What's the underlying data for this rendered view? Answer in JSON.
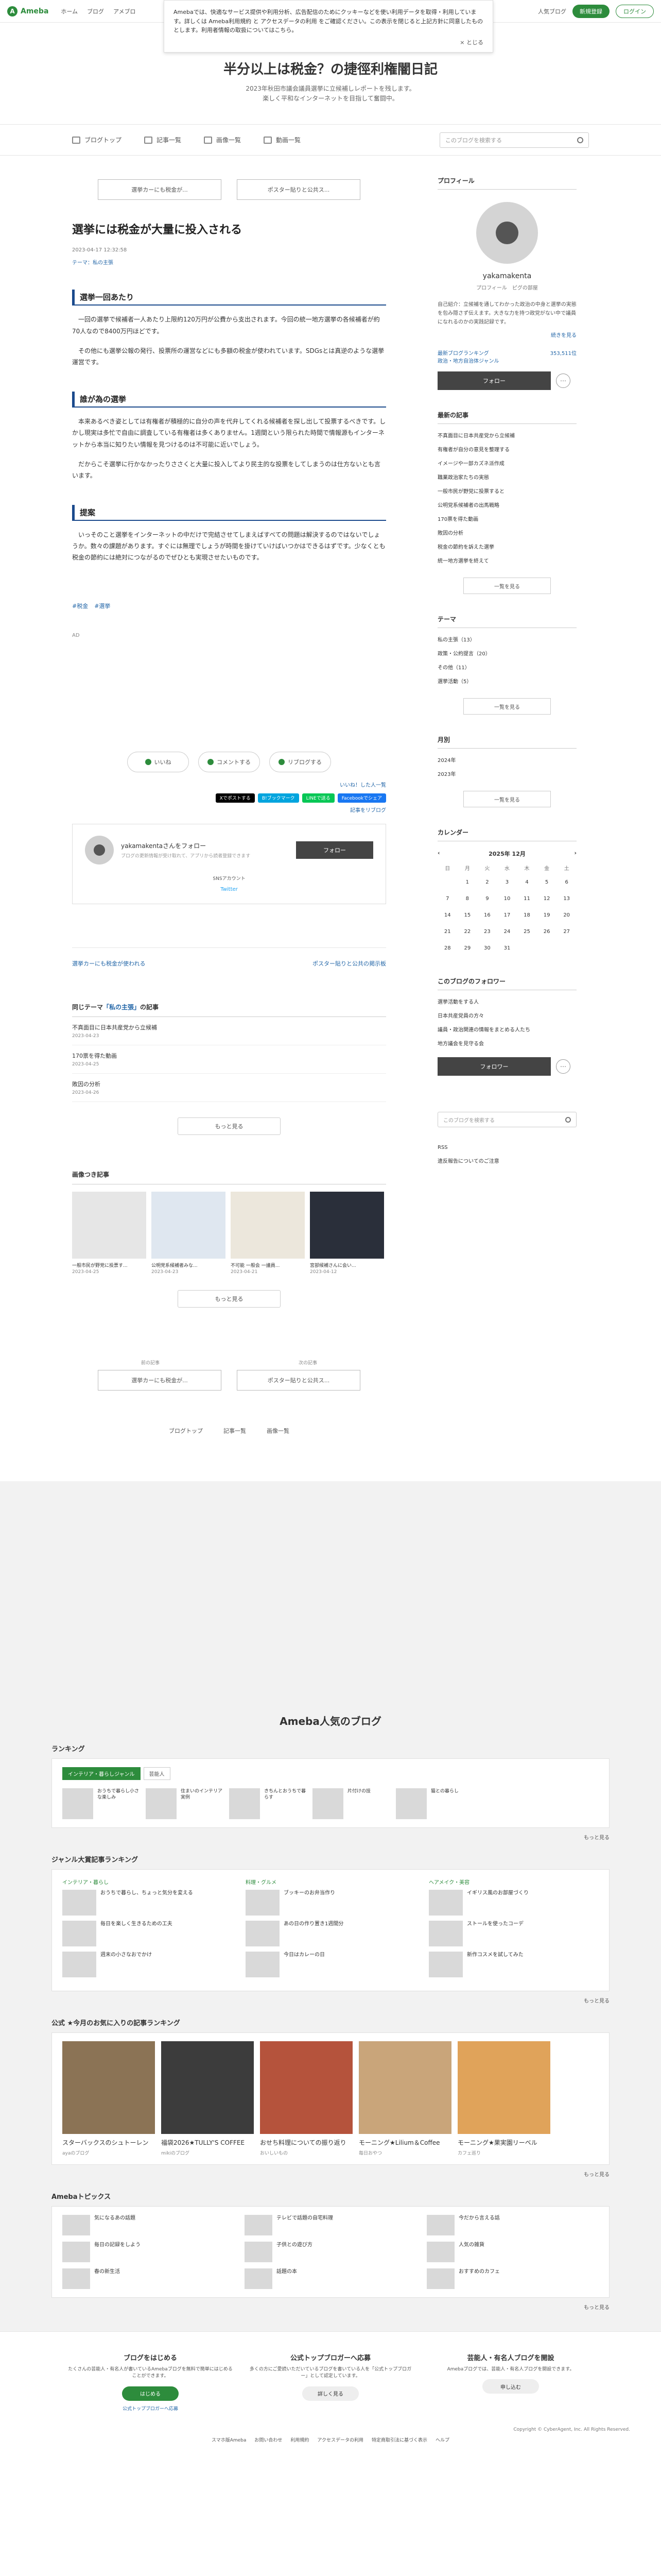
{
  "topbar": {
    "logo": "Ameba",
    "nav": [
      "ホーム",
      "ブログ",
      "アメブロ"
    ],
    "right_label": "人気ブログ",
    "signup": "新規登録",
    "login": "ログイン"
  },
  "cookie": {
    "text": "Amebaでは、快適なサービス提供や利用分析、広告配信のためにクッキーなどを使い利用データを取得・利用しています。詳しくは Ameba利用規約 と アクセスデータの利用 をご確認ください。この表示を閉じると上記方針に同意したものとします。利用者情報の取扱についてはこちら。",
    "close": "× とじる"
  },
  "blog": {
    "title": "半分以上は税金？の捷徑利権闇日記",
    "desc_1": "2023年秋田市議会議員選挙に立候補しレポートを残します。",
    "desc_2": "楽しく平和なインターネットを目指して奮闘中。"
  },
  "gnav": {
    "items": [
      "ブログトップ",
      "記事一覧",
      "画像一覧",
      "動画一覧"
    ],
    "search_placeholder": "このブログを検索する"
  },
  "pager": {
    "prev": "選挙カーにも税金が...",
    "next": "ポスター貼りと公共ス..."
  },
  "entry": {
    "title": "選挙には税金が大量に投入される",
    "meta": "2023-04-17 12:32:58",
    "theme": "テーマ：私の主張",
    "sec1": "選挙一回あたり",
    "p1": "一回の選挙で候補者一人あたり上限約120万円が公費から支出されます。今回の統一地方選挙の各候補者が約70人なので8400万円ほどです。",
    "p2": "その他にも選挙公報の発行、投票所の運営などにも多額の税金が使われています。SDGsとは真逆のような選挙運営です。",
    "sec2": "誰が為の選挙",
    "p3": "本来あるべき姿としては有権者が積極的に自分の声を代弁してくれる候補者を探し出して投票するべきです。しかし現実は多忙で自由に調査している有権者は多くありません。1週間という限られた時間で情報源もインターネットから本当に知りたい情報を見つけるのは不可能に近いでしょう。",
    "p4": "だからこそ選挙に行かなかったりささくと大量に投入してより民主的な投票をしてしまうのは仕方ないとも言います。",
    "sec3": "提案",
    "p5": "いっそのこと選挙をインターネットの中だけで完結させてしまえばすべての問題は解決するのではないでしょうか。数々の課題があります。すぐには無理でしょうが時間を掛けていけばいつかはできるはずです。少なくとも税金の節約には絶対につながるのでぜひとも実現させたいものです。",
    "hashtags": [
      "#税金",
      "#選挙"
    ],
    "ad": "AD"
  },
  "actions": {
    "like": "いいね",
    "comment": "コメントする",
    "reblog": "リブログする",
    "like_list": "いいね！した人一覧",
    "share": [
      "Xでポストする",
      "B!ブックマーク",
      "LINEで送る",
      "Facebookでシェア"
    ],
    "reblog_link": "記事をリブログ"
  },
  "follow_box": {
    "name": "yakamakentaさんをフォロー",
    "sub": "ブログの更新情報が受け取れて、アプリから読者登録できます",
    "follow": "フォロー",
    "sns": "SNSアカウント",
    "twitter": "Twitter"
  },
  "nav_links": {
    "prev": "選挙カーにも税金が使われる",
    "next": "ポスター貼りと公共の掲示板"
  },
  "same_theme": {
    "head_prefix": "同じテーマ",
    "head_theme": "「私の主張」",
    "head_suffix": "の記事",
    "items": [
      {
        "title": "不真面目に日本共産党から立候補",
        "date": "2023-04-23"
      },
      {
        "title": "170票を得た動画",
        "date": "2023-04-25"
      },
      {
        "title": "敗因の分析",
        "date": "2023-04-26"
      }
    ],
    "more": "もっと見る"
  },
  "image_articles": {
    "head": "画像つき記事",
    "items": [
      {
        "cap": "一般市民が野党に投票す...",
        "date": "2023-04-25"
      },
      {
        "cap": "公明党系候補者みな...",
        "date": "2023-04-23"
      },
      {
        "cap": "不可能 一般会 一議員...",
        "date": "2023-04-21"
      },
      {
        "cap": "宮部候補さんに会い...",
        "date": "2023-04-12"
      }
    ],
    "more": "もっと見る"
  },
  "bottom": {
    "prev_label": "前の記事",
    "next_label": "次の記事",
    "prev": "選挙カーにも税金が...",
    "next": "ポスター貼りと公共ス...",
    "nav": [
      "ブログトップ",
      "記事一覧",
      "画像一覧"
    ]
  },
  "sidebar": {
    "profile_title": "プロフィール",
    "name": "yakamakenta",
    "sub": "プロフィール　ピグの部屋",
    "desc": "自己紹介：立候補を通してわかった政治の中身と選挙の実態を包み隠さず伝えます。大きな力を持つ政党がない中で議員になれるのかの実践記録です。",
    "desc_link": "続きを見る",
    "rank_label": "最新ブログランキング",
    "rank_genre": "政治・地方自治体ジャンル",
    "rank_value": "353,511位",
    "follow": "フォロー",
    "recent_title": "最新の記事",
    "recent": [
      "不真面目に日本共産党から立候補",
      "有権者が自分の意見を整理する",
      "イメージや一部カズネ派作成",
      "職業政治家たちの実態",
      "一般市民が野党に投票すると",
      "公明党系候補者の出馬戦略",
      "170票を得た動画",
      "敗因の分析",
      "税金の節約を訴えた選挙",
      "統一地方選挙を終えて"
    ],
    "recent_more": "一覧を見る",
    "theme_title": "テーマ",
    "themes": [
      "私の主張（13）",
      "政策・公約提言（20）",
      "その他（11）",
      "選挙活動（5）"
    ],
    "theme_more": "一覧を見る",
    "month_title": "月別",
    "months": [
      "2024年",
      "2023年"
    ],
    "month_more": "一覧を見る",
    "cal_title": "カレンダー",
    "cal_month": "2025年 12月",
    "cal_days": [
      "日",
      "月",
      "火",
      "水",
      "木",
      "金",
      "土"
    ],
    "cal_weeks": [
      [
        "",
        "1",
        "2",
        "3",
        "4",
        "5",
        "6"
      ],
      [
        "7",
        "8",
        "9",
        "10",
        "11",
        "12",
        "13"
      ],
      [
        "14",
        "15",
        "16",
        "17",
        "18",
        "19",
        "20"
      ],
      [
        "21",
        "22",
        "23",
        "24",
        "25",
        "26",
        "27"
      ],
      [
        "28",
        "29",
        "30",
        "31",
        "",
        "",
        ""
      ]
    ],
    "fw_title": "このブログのフォロワー",
    "fw": [
      "選挙活動をする人",
      "日本共産党員の方々",
      "議員・政治関連の情報をまとめる人たち",
      "地方議会を見守る会"
    ],
    "fw_more": "フォロワー",
    "search_placeholder": "このブログを検索する",
    "rss": "RSS",
    "report": "違反報告についてのご注意"
  },
  "popular": {
    "title": "Ameba人気のブログ",
    "ranking_head": "ランキング",
    "tabs": [
      "インテリア・暮らしジャンル",
      "芸能人"
    ],
    "ranking_items": [
      "おうちで暮らし小さな楽しみ",
      "住まいのインテリア実例",
      "きちんとおうちで暮らす",
      "片付けの技",
      "猫との暮らし"
    ],
    "more": "もっと見る",
    "genre_head": "ジャンル大賞記事ランキング",
    "genre_cols": [
      {
        "h": "インテリア・暮らし",
        "items": [
          "おうちで暮らし、ちょっと気分を変える",
          "毎日を楽しく生きるための工夫",
          "週末の小さなおでかけ"
        ]
      },
      {
        "h": "料理・グルメ",
        "items": [
          "ブッキーのお弁当作り",
          "あの日の作り置き1週間分",
          "今日はカレーの日"
        ]
      },
      {
        "h": "ヘアメイク・美容",
        "items": [
          "イギリス風のお部屋づくり",
          "ストールを使ったコーデ",
          "新作コスメを試してみた"
        ]
      }
    ],
    "official_head": "公式 ★今月のお気に入りの記事ランキング",
    "official": [
      {
        "tx": "スターバックスのシュトーレン",
        "by": "ayaのブログ"
      },
      {
        "tx": "福袋2026★TULLY'S COFFEE",
        "by": "mikiのブログ"
      },
      {
        "tx": "おせち料理についての振り返り",
        "by": "おいしいもの"
      },
      {
        "tx": "モーニング★Lilium＆Coffee",
        "by": "毎日おやつ"
      },
      {
        "tx": "モーニング★果実園リーベル",
        "by": "カフェ巡り"
      }
    ],
    "topics_head": "Amebaトピックス",
    "topics": [
      "気になるあの話題",
      "テレビで話題の自宅料理",
      "今だから言える話",
      "毎日の記録をしよう",
      "子供との遊び方",
      "人気の雑貨",
      "春の新生活",
      "話題の本",
      "おすすめのカフェ"
    ]
  },
  "promo": [
    {
      "h": "ブログをはじめる",
      "t": "たくさんの芸能人・有名人が書いているAmebaブログを無料で簡単にはじめることができます。",
      "b": "はじめる",
      "l": "公式トップブロガーへ応募"
    },
    {
      "h": "公式トップブロガーへ応募",
      "t": "多くの方にご愛読いただいているブログを書いている人を「公式トップブロガー」として認定しています。",
      "b": "詳しく見る",
      "l": ""
    },
    {
      "h": "芸能人・有名人ブログを開設",
      "t": "Amebaブログでは、芸能人・有名人ブログを開設できます。",
      "b": "申し込む",
      "l": ""
    }
  ],
  "footer": {
    "copy": "Copyright © CyberAgent, Inc. All Rights Reserved.",
    "links": [
      "スマホ版Ameba",
      "お問い合わせ",
      "利用規約",
      "アクセスデータの利用",
      "特定商取引法に基づく表示",
      "ヘルプ"
    ]
  }
}
